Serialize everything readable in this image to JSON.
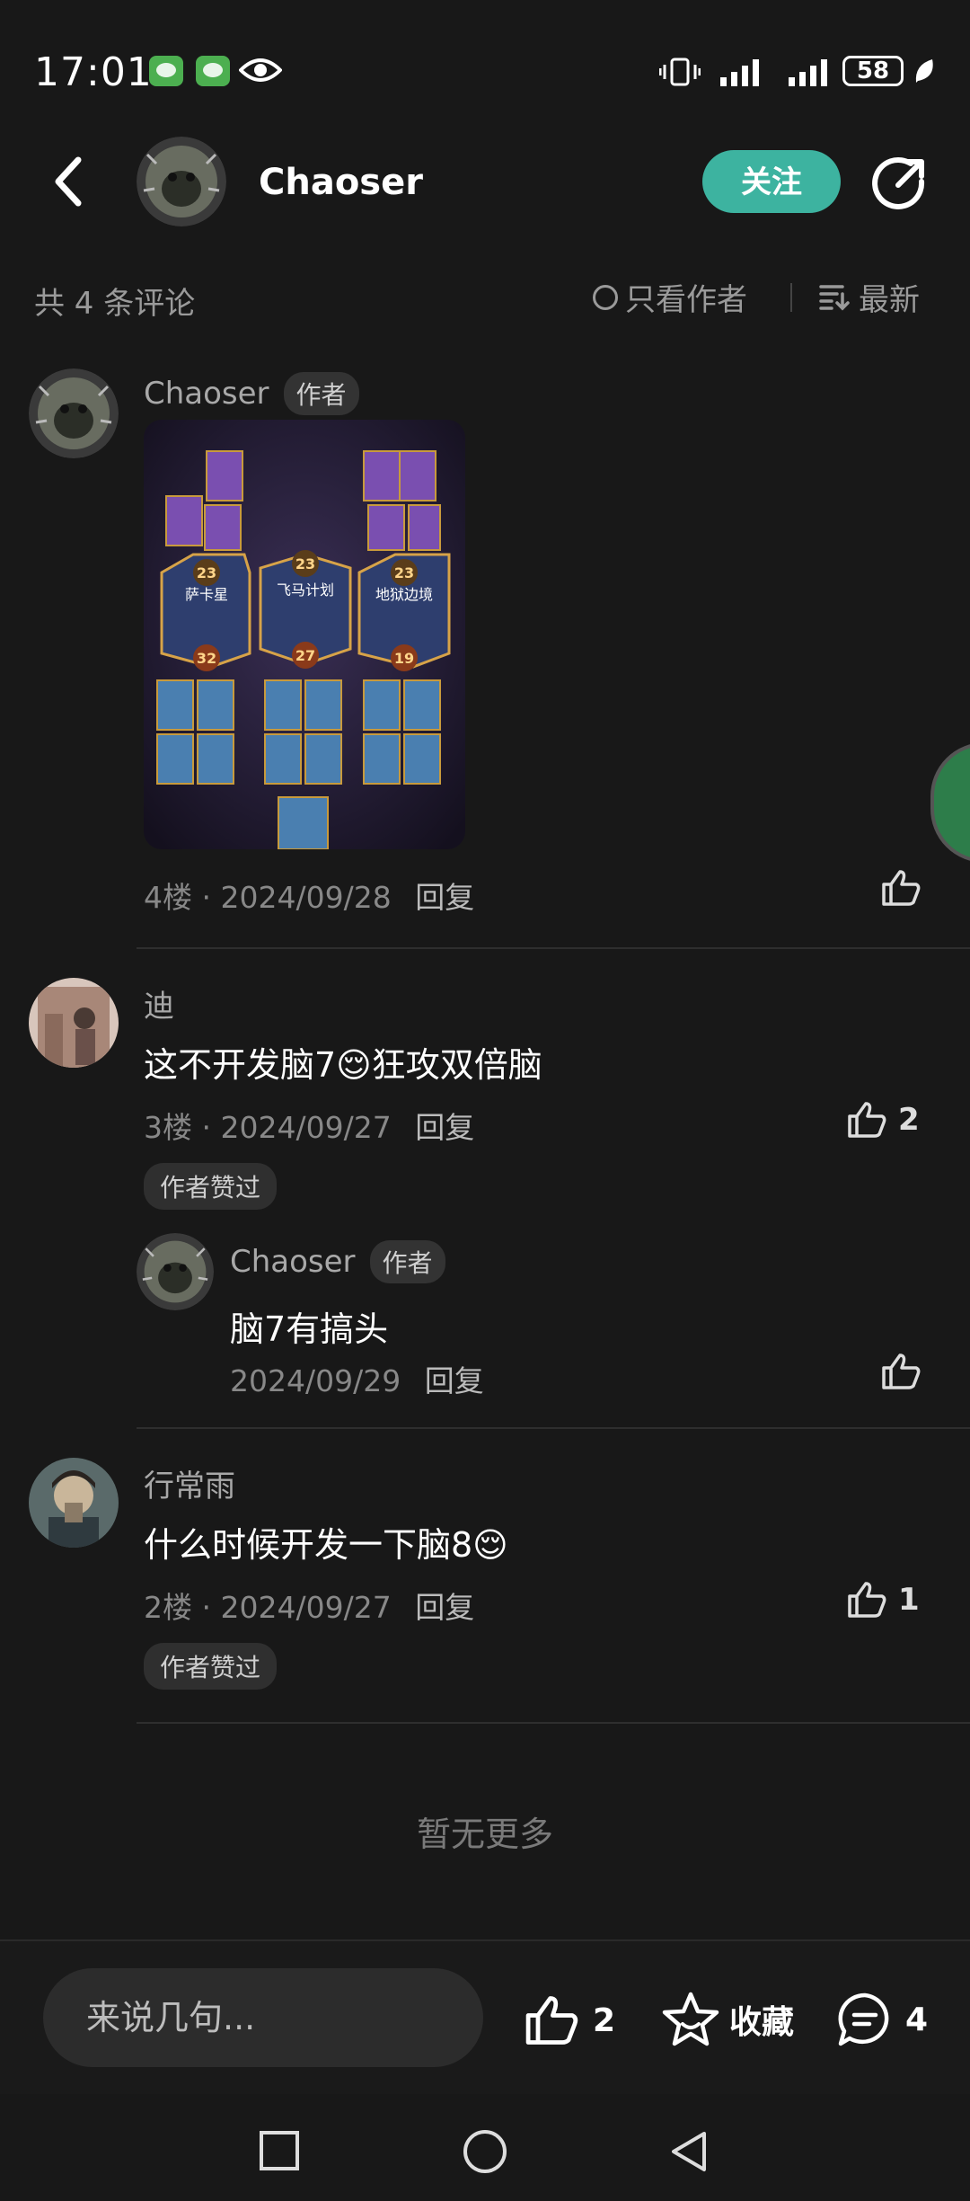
{
  "status_bar": {
    "time": "17:01",
    "battery": "58"
  },
  "header": {
    "name": "Chaoser",
    "follow_label": "关注"
  },
  "toolbar": {
    "count_text": "共 4 条评论",
    "only_author_label": "只看作者",
    "sort_label": "最新"
  },
  "comments": [
    {
      "user": "Chaoser",
      "author_tag": "作者",
      "floor": "4楼",
      "date": "2024/09/28",
      "reply_label": "回复",
      "has_image": true,
      "deck_labels": [
        "萨卡星",
        "飞马计划",
        "地狱边境"
      ],
      "deck_costs": [
        "23",
        "23",
        "23",
        "32",
        "27",
        "19"
      ]
    },
    {
      "user": "迪",
      "text": "这不开发脑7😌狂攻双倍脑",
      "floor": "3楼",
      "date": "2024/09/27",
      "reply_label": "回复",
      "likes": "2",
      "liked_tag": "作者赞过",
      "reply": {
        "user": "Chaoser",
        "author_tag": "作者",
        "text": "脑7有搞头",
        "date": "2024/09/29",
        "reply_label": "回复"
      }
    },
    {
      "user": "行常雨",
      "text": "什么时候开发一下脑8😌",
      "floor": "2楼",
      "date": "2024/09/27",
      "reply_label": "回复",
      "likes": "1",
      "liked_tag": "作者赞过"
    }
  ],
  "footer": {
    "no_more": "暂无更多"
  },
  "bottom_bar": {
    "input_placeholder": "来说几句...",
    "like_count": "2",
    "favorite_label": "收藏",
    "comment_count": "4"
  },
  "colors": {
    "background": "#181818",
    "accent": "#3db3a0",
    "text": "#e8e8e8",
    "muted": "#888888"
  },
  "icons": [
    "wechat-icon",
    "eye-icon",
    "vibrate-icon",
    "signal-icon",
    "battery-icon",
    "leaf-icon",
    "back-icon",
    "share-icon",
    "sort-icon",
    "thumb-up-icon",
    "star-icon",
    "comment-icon",
    "square-nav-icon",
    "circle-nav-icon",
    "triangle-back-icon"
  ]
}
